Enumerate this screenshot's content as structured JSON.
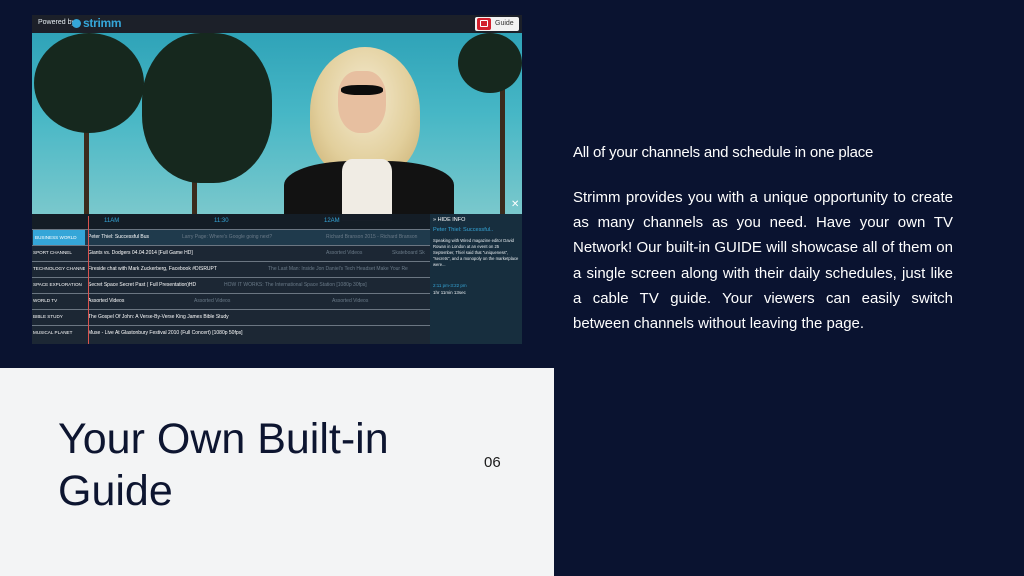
{
  "screenshot": {
    "powered_by": "Powered by",
    "brand": "strimm",
    "guide_button": "Guide",
    "close_symbol": "✕",
    "guide": {
      "times": [
        "11AM",
        "11:30",
        "12AM"
      ],
      "channels": [
        {
          "name": "BUSINESS WORLD",
          "programs": [
            "Peter Thiel: Successful Bus",
            "Larry Page: Where's Google going next?",
            "Richard Branson 2015 - Richard Branson"
          ]
        },
        {
          "name": "SPORT CHANNEL",
          "programs": [
            "Giants vs. Dodgers 04.04.2014 [Full Game HD]",
            "Assorted Videos",
            "Skateboard Sk"
          ]
        },
        {
          "name": "TECHNOLOGY CHANNEL",
          "programs": [
            "Fireside chat with Mark Zuckerberg, Facebook #DISRUPT",
            "The Last Man: Inside Jon Daniel's Tech Headset Make Your Re"
          ]
        },
        {
          "name": "SPACE EXPLORATION",
          "programs": [
            "Secret Space Secret Past ( Full Presentation)HD",
            "HOW IT WORKS: The International Space Station [1080p 30fps]"
          ]
        },
        {
          "name": "WORLD TV",
          "programs": [
            "Assorted Videos",
            "Assorted Videos",
            "Assorted Videos"
          ]
        },
        {
          "name": "BIBLE STUDY",
          "programs": [
            "The Gospel Of John: A Verse-By-Verse King James Bible Study"
          ]
        },
        {
          "name": "MUSICAL PLANET",
          "programs": [
            "Muse - Live At Glastonbury Festival 2010 (Full Concert) [1080p 50fps]"
          ]
        }
      ],
      "info": {
        "hide_label": "HIDE INFO",
        "title": "Peter Thiel: Successful..",
        "description": "Speaking with Wired magazine editor David Rowan in London at an event on 25 September, Thiel said that \"uniqueness\", \"secrets\", and a monopoly on the marketplace were...",
        "time": "2:11 pm-3:22 pm",
        "duration": "1hr 11min 13sec"
      }
    }
  },
  "slide": {
    "subtitle": "All of your channels and schedule in one place",
    "body": "Strimm provides you with a unique opportunity to create as many channels as you need. Have your own TV Network! Our built-in GUIDE will showcase all of them on a single screen along with their daily schedules, just like a cable TV guide. Your viewers can easily  switch between channels without leaving the page.",
    "title": "Your Own Built-in Guide",
    "page_number": "06"
  }
}
